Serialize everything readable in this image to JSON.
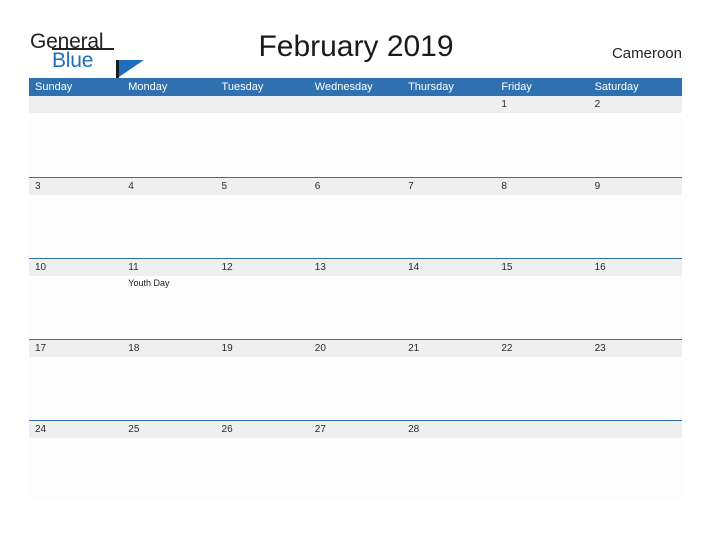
{
  "brand": {
    "name_part1": "General",
    "name_part2": "Blue",
    "flag_icon": "flag-triangle-icon"
  },
  "header": {
    "title": "February 2019",
    "region": "Cameroon"
  },
  "calendar": {
    "day_headers": [
      "Sunday",
      "Monday",
      "Tuesday",
      "Wednesday",
      "Thursday",
      "Friday",
      "Saturday"
    ],
    "colors": {
      "header_blue": "#2f71b0",
      "day_band_gray": "#efefef",
      "brand_blue": "#1f6fbf",
      "text_dark": "#1a1a1a"
    },
    "weeks": [
      [
        {
          "date": "",
          "events": []
        },
        {
          "date": "",
          "events": []
        },
        {
          "date": "",
          "events": []
        },
        {
          "date": "",
          "events": []
        },
        {
          "date": "",
          "events": []
        },
        {
          "date": "1",
          "events": []
        },
        {
          "date": "2",
          "events": []
        }
      ],
      [
        {
          "date": "3",
          "events": []
        },
        {
          "date": "4",
          "events": []
        },
        {
          "date": "5",
          "events": []
        },
        {
          "date": "6",
          "events": []
        },
        {
          "date": "7",
          "events": []
        },
        {
          "date": "8",
          "events": []
        },
        {
          "date": "9",
          "events": []
        }
      ],
      [
        {
          "date": "10",
          "events": []
        },
        {
          "date": "11",
          "events": [
            "Youth Day"
          ]
        },
        {
          "date": "12",
          "events": []
        },
        {
          "date": "13",
          "events": []
        },
        {
          "date": "14",
          "events": []
        },
        {
          "date": "15",
          "events": []
        },
        {
          "date": "16",
          "events": []
        }
      ],
      [
        {
          "date": "17",
          "events": []
        },
        {
          "date": "18",
          "events": []
        },
        {
          "date": "19",
          "events": []
        },
        {
          "date": "20",
          "events": []
        },
        {
          "date": "21",
          "events": []
        },
        {
          "date": "22",
          "events": []
        },
        {
          "date": "23",
          "events": []
        }
      ],
      [
        {
          "date": "24",
          "events": []
        },
        {
          "date": "25",
          "events": []
        },
        {
          "date": "26",
          "events": []
        },
        {
          "date": "27",
          "events": []
        },
        {
          "date": "28",
          "events": []
        },
        {
          "date": "",
          "events": []
        },
        {
          "date": "",
          "events": []
        }
      ]
    ]
  }
}
